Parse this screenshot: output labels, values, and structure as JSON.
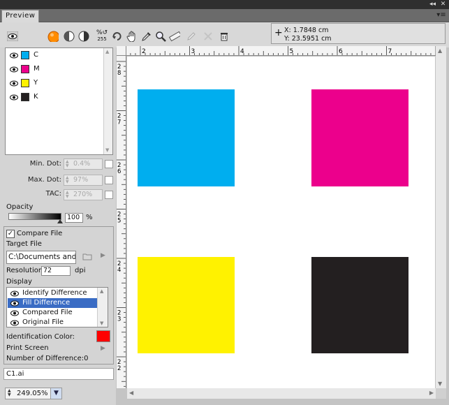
{
  "window": {
    "tab_title": "Preview",
    "top_controls": [
      "collapse-icon",
      "close-icon"
    ]
  },
  "toolbar": {
    "tools": [
      "eye-icon",
      "color-ball-icon",
      "half-circle-icon",
      "half-circle-alt-icon",
      "percent-icon",
      "rotate-icon",
      "hand-icon",
      "eyedropper-icon",
      "zoom-icon",
      "ruler-icon",
      "pen-icon",
      "delete-icon",
      "trash-icon"
    ],
    "percent_sub": "255"
  },
  "coords": {
    "x": "X: 1.7848 cm",
    "y": "Y: 23.5951 cm"
  },
  "channels": [
    {
      "label": "C",
      "color": "#00aeef"
    },
    {
      "label": "M",
      "color": "#ec008c"
    },
    {
      "label": "Y",
      "color": "#fff200"
    },
    {
      "label": "K",
      "color": "#231f20"
    }
  ],
  "params": {
    "min_dot_label": "Min. Dot:",
    "min_dot_value": "0.4%",
    "max_dot_label": "Max. Dot:",
    "max_dot_value": "97%",
    "tac_label": "TAC:",
    "tac_value": "270%"
  },
  "opacity": {
    "label": "Opacity",
    "value": "100",
    "unit": "%",
    "level": 1.0
  },
  "compare": {
    "label": "Compare File",
    "checked": true,
    "target_label": "Target File",
    "target_value": "C:\\Documents and Settings",
    "resolution_label": "Resolution:",
    "resolution_value": "72",
    "resolution_unit": "dpi",
    "display_label": "Display",
    "display_items": [
      "Identify Difference",
      "Fill Difference",
      "Compared File",
      "Original File"
    ],
    "display_selected": 1,
    "id_color_label": "Identification Color:",
    "id_color": "#ff0000",
    "print_screen_label": "Print Screen",
    "diff_count_label": "Number of Difference:0"
  },
  "file_name": "C1.ai",
  "zoom": "249.05%",
  "ruler": {
    "h_labels": [
      "2",
      "3",
      "4",
      "5",
      "6",
      "7"
    ],
    "v_labels": [
      "28",
      "27",
      "26",
      "25",
      "24",
      "23",
      "22"
    ]
  }
}
